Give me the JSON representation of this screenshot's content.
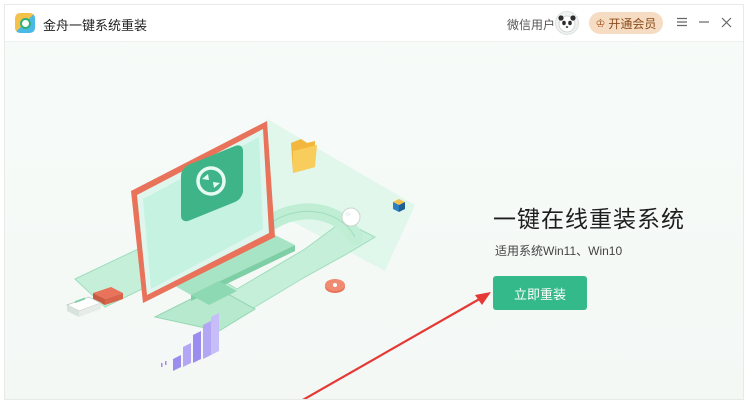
{
  "app": {
    "title": "金舟一键系统重装",
    "icon": "app-logo-icon"
  },
  "header": {
    "user_label": "微信用户",
    "avatar_icon": "panda-avatar-icon",
    "vip_label": "开通会员",
    "vip_icon": "crown-icon",
    "menu_icon": "menu-icon",
    "minimize_icon": "minimize-icon",
    "close_icon": "close-icon"
  },
  "main": {
    "headline": "一键在线重装系统",
    "subline": "适用系统Win11、Win10",
    "install_label": "立即重装"
  },
  "colors": {
    "accent": "#33b98a",
    "vip_bg": "#f5dcc2",
    "annotation_arrow": "#e53935"
  }
}
